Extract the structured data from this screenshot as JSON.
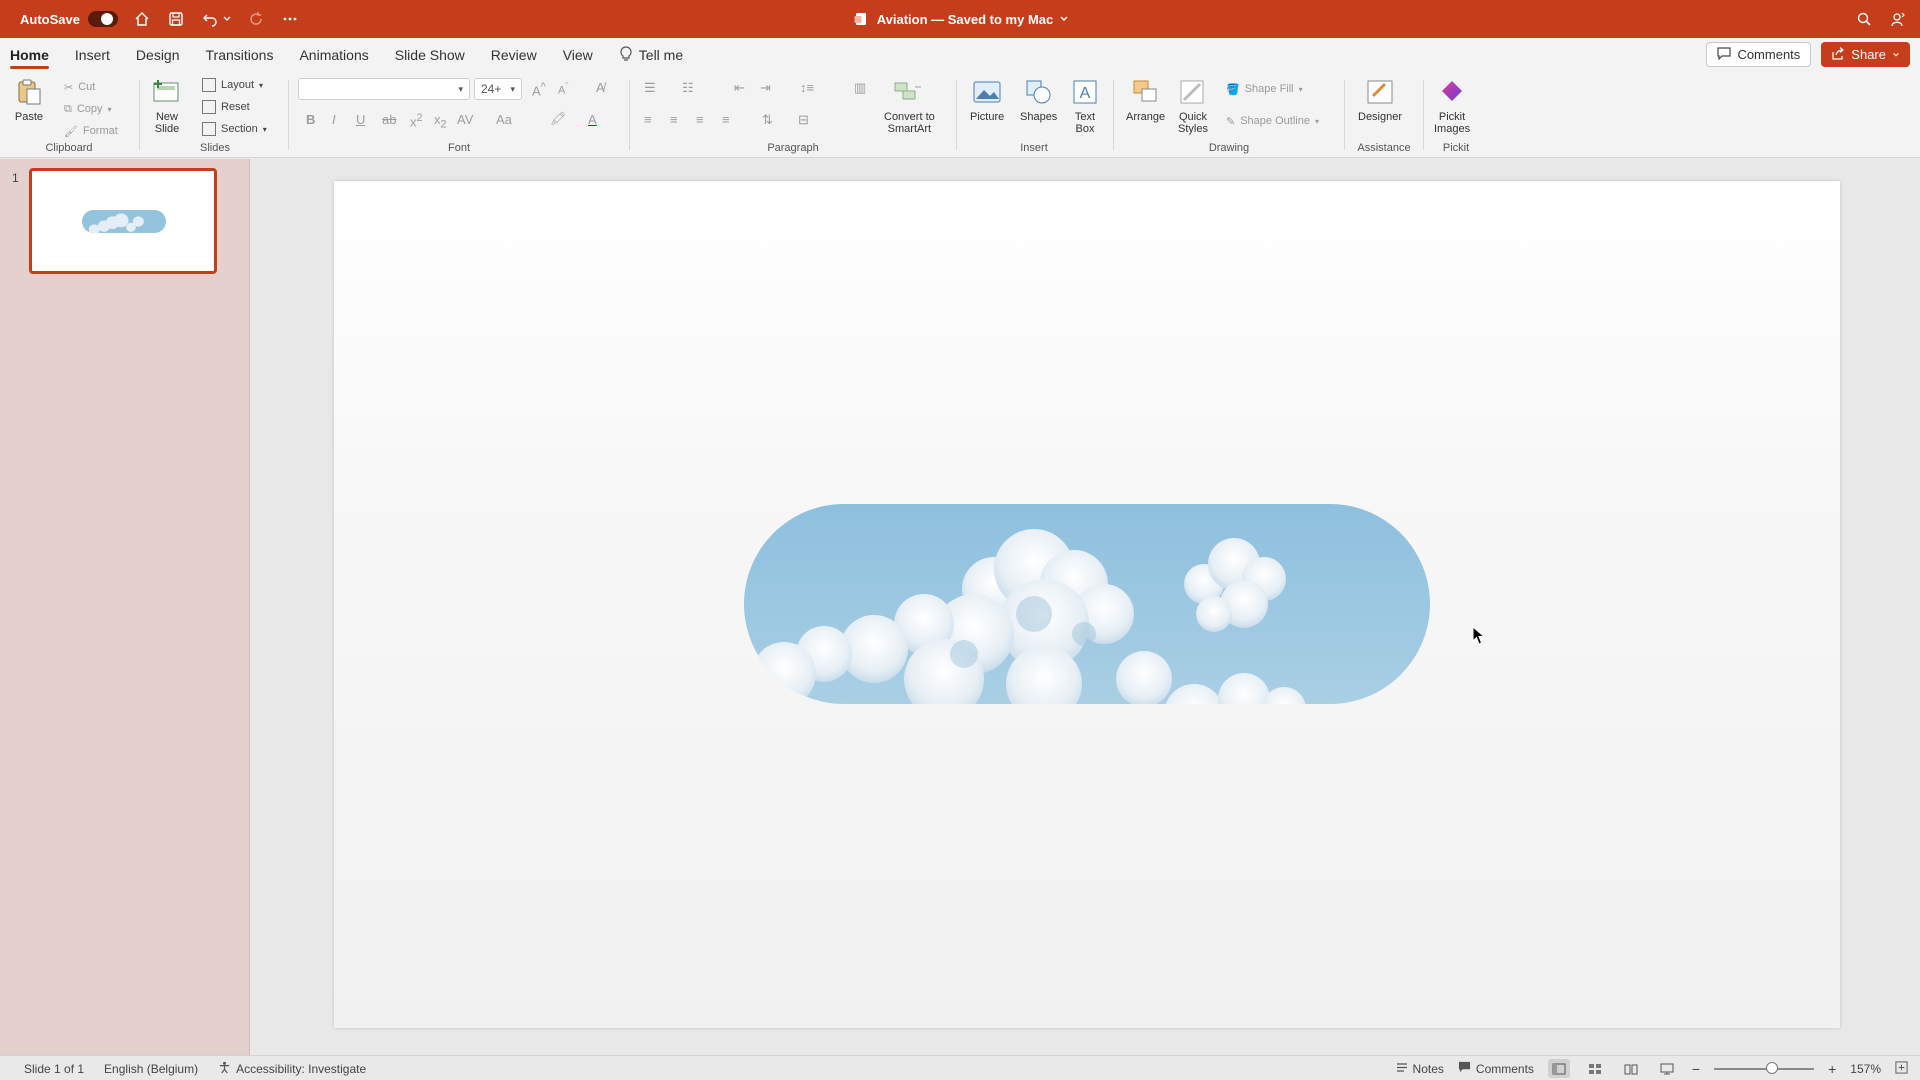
{
  "titlebar": {
    "autosave_label": "AutoSave",
    "title": "Aviation — Saved to my Mac",
    "colors": {
      "bar": "#c43e1c"
    }
  },
  "tabs": [
    "Home",
    "Insert",
    "Design",
    "Transitions",
    "Animations",
    "Slide Show",
    "Review",
    "View"
  ],
  "tell_me": "Tell me",
  "actions": {
    "comments": "Comments",
    "share": "Share"
  },
  "ribbon": {
    "clipboard": {
      "paste": "Paste",
      "cut": "Cut",
      "copy": "Copy",
      "format": "Format",
      "label": "Clipboard"
    },
    "slides": {
      "new_slide_line1": "New",
      "new_slide_line2": "Slide",
      "layout": "Layout",
      "reset": "Reset",
      "section": "Section",
      "label": "Slides"
    },
    "font": {
      "family": "",
      "size": "24+",
      "label": "Font"
    },
    "paragraph": {
      "convert_line1": "Convert to",
      "convert_line2": "SmartArt",
      "label": "Paragraph"
    },
    "insert": {
      "picture": "Picture",
      "shapes": "Shapes",
      "textbox_line1": "Text",
      "textbox_line2": "Box",
      "label": "Insert"
    },
    "drawing": {
      "arrange": "Arrange",
      "quick_line1": "Quick",
      "quick_line2": "Styles",
      "shape_fill": "Shape Fill",
      "shape_outline": "Shape Outline",
      "label": "Drawing"
    },
    "assistance": {
      "designer": "Designer",
      "label": "Assistance"
    },
    "pickit": {
      "line1": "Pickit",
      "line2": "Images",
      "label": "Pickit"
    }
  },
  "slides_pane": {
    "slide_number": "1"
  },
  "statusbar": {
    "slide_info": "Slide 1 of 1",
    "language": "English (Belgium)",
    "accessibility": "Accessibility: Investigate",
    "notes": "Notes",
    "comments": "Comments",
    "zoom": "157%",
    "zoom_level": 0.58
  },
  "icons": [
    "home-icon",
    "save-icon",
    "undo-icon",
    "redo-icon",
    "more-icon",
    "search-icon",
    "person-icon",
    "lightbulb-icon"
  ]
}
